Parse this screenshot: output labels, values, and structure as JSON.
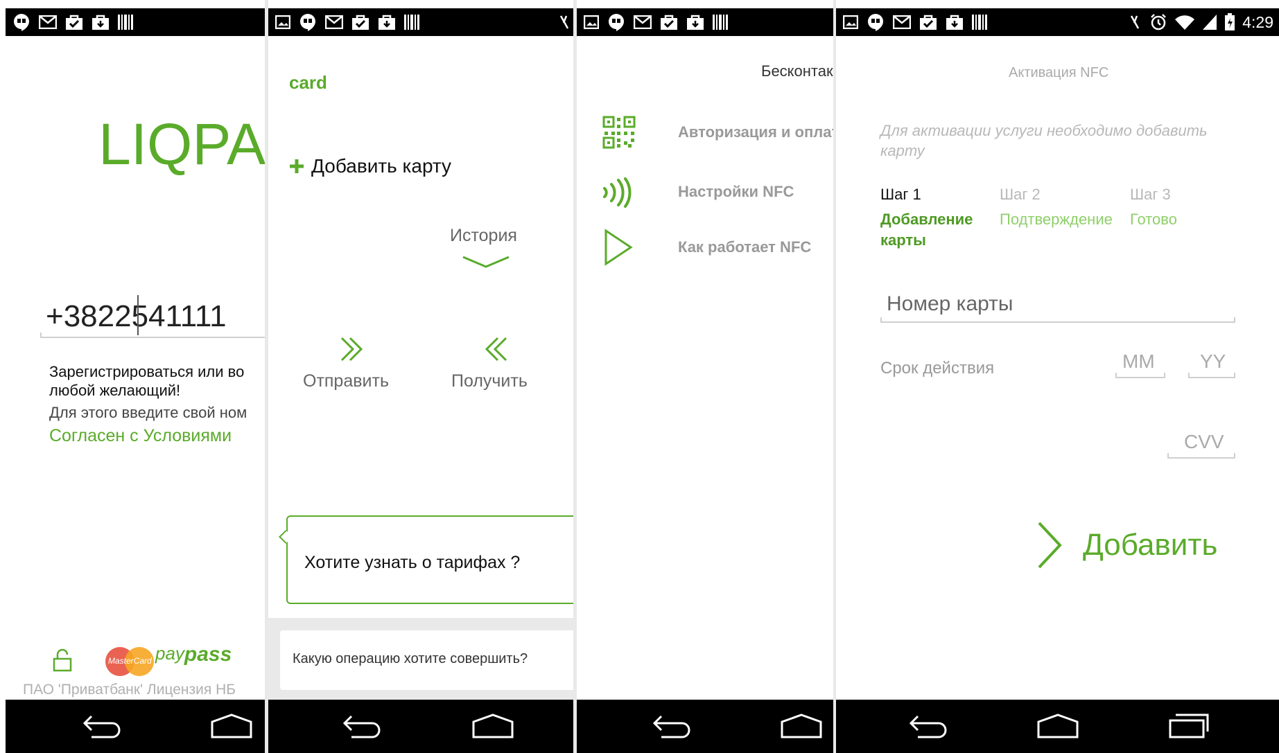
{
  "status_bar": {
    "time": "4:29"
  },
  "screen1": {
    "logo": "LIQPA",
    "phone_value": "+3822541111",
    "text_line1": "Зарегистрироваться или во",
    "text_line2": "любой желающий!",
    "text_line3": "Для этого введите свой ном",
    "terms_link": "Согласен с Условиями",
    "paypass_label_1": "pay",
    "paypass_label_2": "pass",
    "mastercard_label": "MasterCard",
    "footer": "ПАО 'Приватбанк' Лицензия НБ"
  },
  "screen2": {
    "title": "card",
    "add_card": "Добавить карту",
    "history": "История",
    "send": "Отправить",
    "receive": "Получить",
    "tariffs": "Хотите узнать о тарифах ?",
    "operation_prompt": "Какую операцию хотите совершить?"
  },
  "screen3": {
    "title": "Бесконтак",
    "items": [
      {
        "label": "Авторизация и оплата",
        "icon": "qr-code-icon"
      },
      {
        "label": "Настройки NFC",
        "icon": "nfc-icon"
      },
      {
        "label": "Как работает NFC",
        "icon": "play-icon"
      }
    ]
  },
  "screen4": {
    "title": "Активация NFC",
    "hint": "Для активации услуги необходимо добавить карту",
    "steps": [
      {
        "num": "Шаг 1",
        "label": "Добавление карты"
      },
      {
        "num": "Шаг 2",
        "label": "Подтверждение"
      },
      {
        "num": "Шаг 3",
        "label": "Готово"
      }
    ],
    "card_number_placeholder": "Номер карты",
    "expiry_label": "Срок действия",
    "month_placeholder": "MM",
    "year_placeholder": "YY",
    "cvv_placeholder": "CVV",
    "add_button": "Добавить"
  },
  "colors": {
    "accent": "#5aab2a",
    "text": "#222222",
    "muted": "#9a9a9a"
  }
}
